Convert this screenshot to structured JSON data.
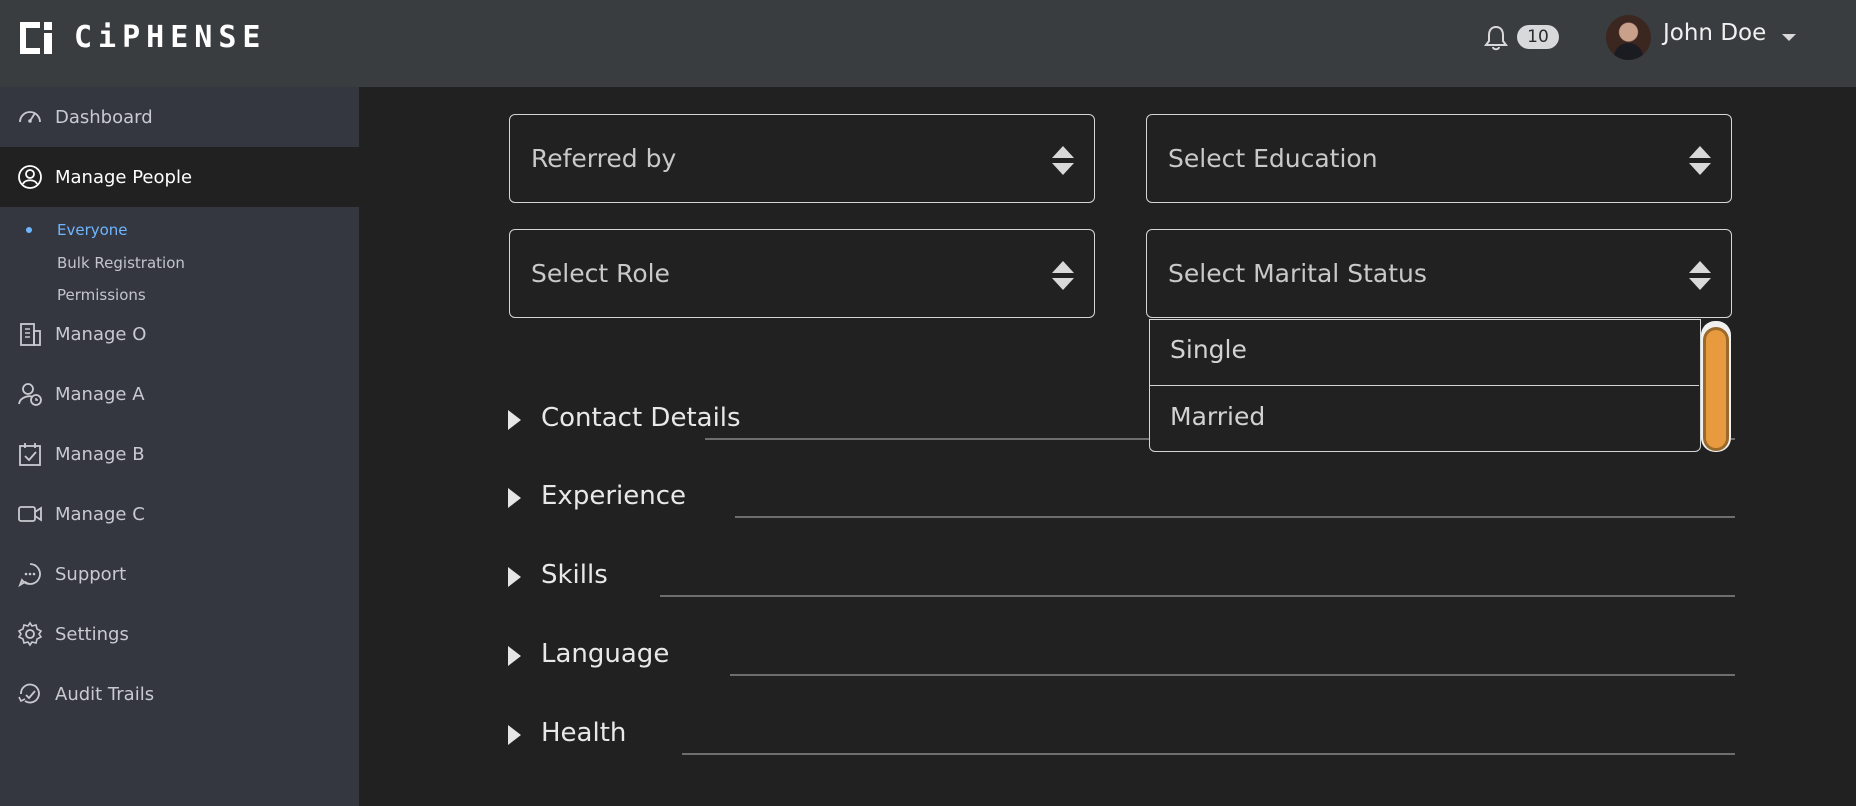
{
  "app": {
    "brand": "CiPHENSE"
  },
  "header": {
    "notification_count": "10",
    "user_name": "John Doe"
  },
  "sidebar": {
    "items": [
      {
        "label": "Dashboard",
        "icon": "speedometer-icon"
      },
      {
        "label": "Manage People",
        "icon": "user-circle-icon",
        "active": true
      },
      {
        "label": "Manage O",
        "icon": "building-icon"
      },
      {
        "label": "Manage A",
        "icon": "user-clock-icon"
      },
      {
        "label": "Manage B",
        "icon": "calendar-check-icon"
      },
      {
        "label": "Manage C",
        "icon": "video-camera-icon"
      },
      {
        "label": "Support",
        "icon": "chat-bubble-icon"
      },
      {
        "label": "Settings",
        "icon": "gear-icon"
      },
      {
        "label": "Audit Trails",
        "icon": "history-icon"
      }
    ],
    "sub_items": [
      {
        "label": "Everyone",
        "active": true
      },
      {
        "label": "Bulk Registration"
      },
      {
        "label": "Permissions"
      }
    ]
  },
  "form": {
    "referred_by": "Referred by",
    "education": "Select Education",
    "role": "Select Role",
    "marital_status": "Select Marital Status",
    "marital_options": [
      "Single",
      "Married"
    ]
  },
  "sections": [
    {
      "label": "Contact Details"
    },
    {
      "label": "Experience"
    },
    {
      "label": "Skills"
    },
    {
      "label": "Language"
    },
    {
      "label": "Health"
    }
  ],
  "colors": {
    "header_bg": "#3a3d3f",
    "sidebar_bg": "#343740",
    "main_bg": "#212121",
    "accent_blue": "#6fb6ff",
    "scroll_thumb": "#e89a3e"
  }
}
